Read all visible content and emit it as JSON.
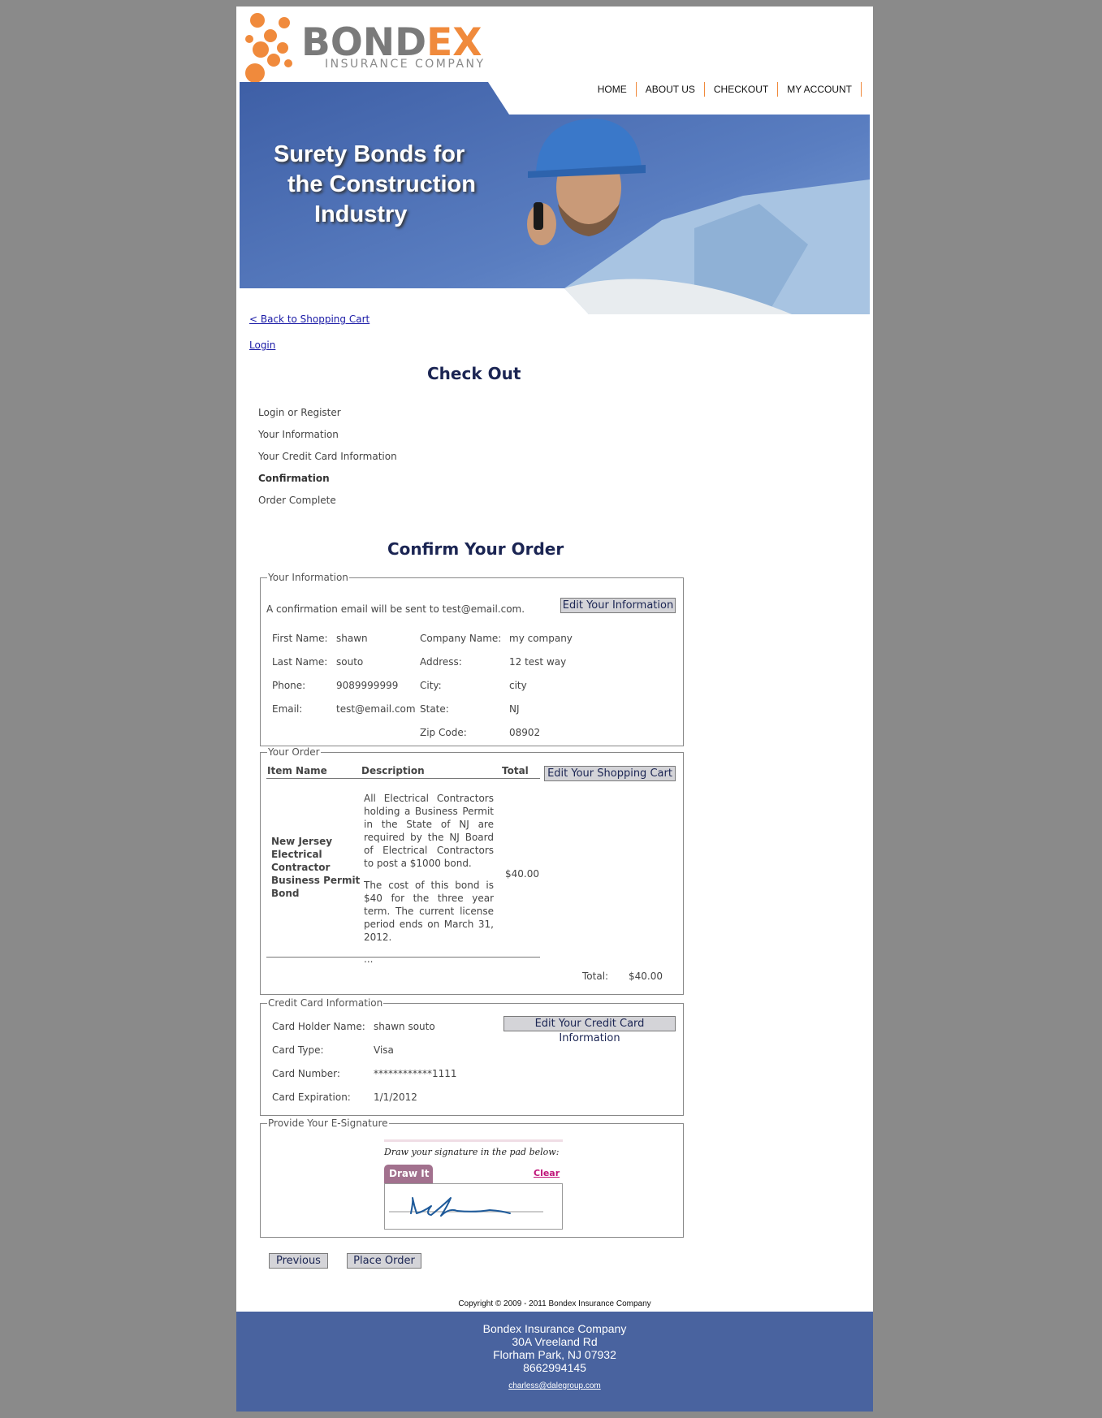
{
  "logo": {
    "word_grey": "BOND",
    "word_orange": "EX",
    "subtitle": "INSURANCE COMPANY"
  },
  "nav": {
    "items": [
      "HOME",
      "ABOUT US",
      "CHECKOUT",
      "MY ACCOUNT"
    ]
  },
  "banner": {
    "line1": "Surety Bonds for",
    "line2": "the Construction",
    "line3": "Industry"
  },
  "links": {
    "back": "< Back to Shopping Cart",
    "login": "Login"
  },
  "checkout": {
    "title": "Check Out",
    "steps": [
      "Login or Register",
      "Your Information",
      "Your Credit Card Information",
      "Confirmation",
      "Order Complete"
    ],
    "active_step": "Confirmation"
  },
  "confirm": {
    "title": "Confirm Your Order"
  },
  "info": {
    "legend": "Your Information",
    "email_note": "A confirmation email will be sent to test@email.com.",
    "edit_button": "Edit Your Information",
    "labels": {
      "first_name": "First Name:",
      "last_name": "Last Name:",
      "phone": "Phone:",
      "email": "Email:",
      "company": "Company Name:",
      "address": "Address:",
      "city": "City:",
      "state": "State:",
      "zip": "Zip Code:"
    },
    "values": {
      "first_name": "shawn",
      "last_name": "souto",
      "phone": "9089999999",
      "email": "test@email.com",
      "company": "my company",
      "address": "12 test way",
      "city": "city",
      "state": "NJ",
      "zip": "08902"
    }
  },
  "order": {
    "legend": "Your Order",
    "headers": {
      "item": "Item Name",
      "description": "Description",
      "total": "Total"
    },
    "edit_button": "Edit Your Shopping Cart",
    "item_name": "New Jersey Electrical Contractor Business Permit Bond",
    "desc_p1": "All Electrical Contractors holding a Business Permit in the State of NJ are required by the NJ Board of Electrical Contractors to post a $1000 bond.",
    "desc_p2": "The cost of this bond is $40 for the three year term. The current license period ends on March 31, 2012.",
    "desc_more": "...",
    "item_total": "$40.00",
    "total_label": "Total:",
    "total_value": "$40.00"
  },
  "card": {
    "legend": "Credit Card Information",
    "edit_button": "Edit Your Credit Card Information",
    "labels": {
      "holder": "Card Holder Name:",
      "type": "Card Type:",
      "number": "Card Number:",
      "expiration": "Card Expiration:"
    },
    "values": {
      "holder": "shawn souto",
      "type": "Visa",
      "number": "************1111",
      "expiration": "1/1/2012"
    }
  },
  "signature": {
    "legend": "Provide Your E-Signature",
    "prompt": "Draw your signature in the pad below:",
    "tab": "Draw It",
    "clear": "Clear"
  },
  "buttons": {
    "previous": "Previous",
    "place_order": "Place Order"
  },
  "copyright": "Copyright © 2009 - 2011 Bondex Insurance Company",
  "footer": {
    "company": "Bondex Insurance Company",
    "street": "30A Vreeland Rd",
    "city": "Florham Park, NJ 07932",
    "phone": "8662994145",
    "email": "charless@dalegroup.com"
  },
  "colors": {
    "accent": "#f08a3c",
    "navy": "#1b2553",
    "footer": "#49639f",
    "background": "#8a8a8a"
  }
}
